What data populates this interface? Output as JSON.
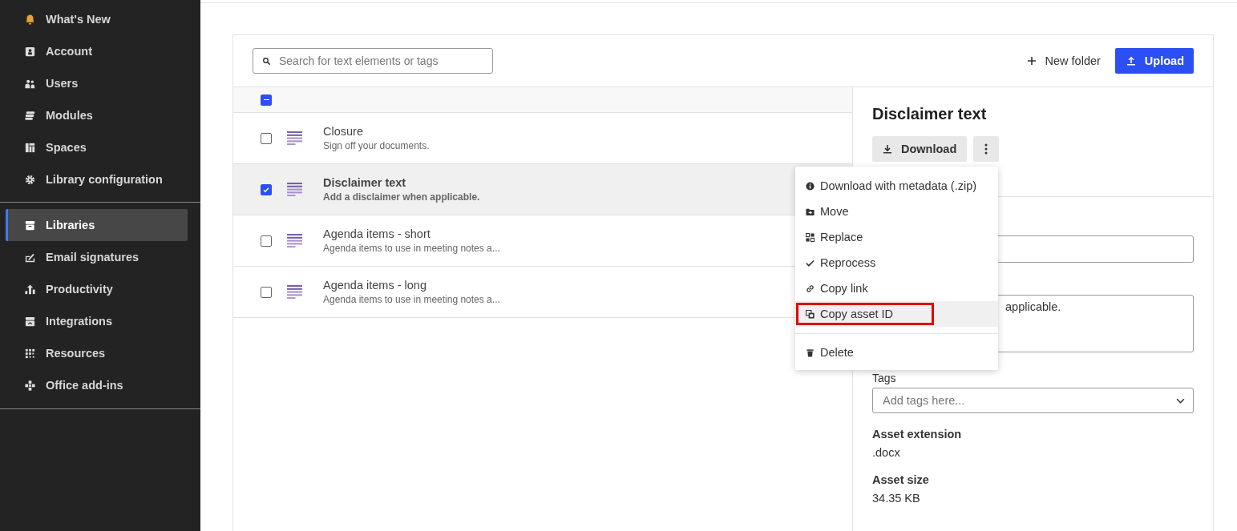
{
  "sidebar": {
    "groups": [
      {
        "items": [
          {
            "label": "What's New",
            "selected": false
          },
          {
            "label": "Account",
            "selected": false
          },
          {
            "label": "Users",
            "selected": false
          },
          {
            "label": "Modules",
            "selected": false
          },
          {
            "label": "Spaces",
            "selected": false
          },
          {
            "label": "Library configuration",
            "selected": false
          }
        ]
      },
      {
        "items": [
          {
            "label": "Libraries",
            "selected": true
          },
          {
            "label": "Email signatures",
            "selected": false
          },
          {
            "label": "Productivity",
            "selected": false
          },
          {
            "label": "Integrations",
            "selected": false
          },
          {
            "label": "Resources",
            "selected": false
          },
          {
            "label": "Office add-ins",
            "selected": false
          }
        ]
      }
    ]
  },
  "toolbar": {
    "search": {
      "placeholder": "Search for text elements or tags"
    },
    "new_folder": "New folder",
    "upload": "Upload"
  },
  "table": {
    "header_checkbox": {
      "indeterminate": true
    },
    "rows": [
      {
        "title": "Closure",
        "description": "Sign off your documents.",
        "checked": false
      },
      {
        "title": "Disclaimer text",
        "description": "Add a disclaimer when applicable.",
        "checked": true
      },
      {
        "title": "Agenda items - short",
        "description": "Agenda items to use in meeting notes a...",
        "checked": false
      },
      {
        "title": "Agenda items - long",
        "description": "Agenda items to use in meeting notes a...",
        "checked": false
      }
    ]
  },
  "details": {
    "title": "Disclaimer text",
    "download": "Download",
    "description_visible": "applicable.",
    "tags_label": "Tags",
    "tags": {
      "placeholder": "Add tags here..."
    },
    "properties": [
      {
        "label": "Asset extension",
        "value": ".docx"
      },
      {
        "label": "Asset size",
        "value": "34.35 KB"
      }
    ]
  },
  "menu": {
    "items": [
      {
        "label": "Download with metadata (.zip)",
        "hovered": false,
        "marked": false
      },
      {
        "label": "Move",
        "hovered": false,
        "marked": false
      },
      {
        "label": "Replace",
        "hovered": false,
        "marked": false
      },
      {
        "label": "Reprocess",
        "hovered": false,
        "marked": false
      },
      {
        "label": "Copy link",
        "hovered": false,
        "marked": false
      },
      {
        "label": "Copy asset ID",
        "hovered": true,
        "marked": true
      }
    ],
    "footer_items": [
      {
        "label": "Delete",
        "hovered": false,
        "marked": false
      }
    ]
  }
}
